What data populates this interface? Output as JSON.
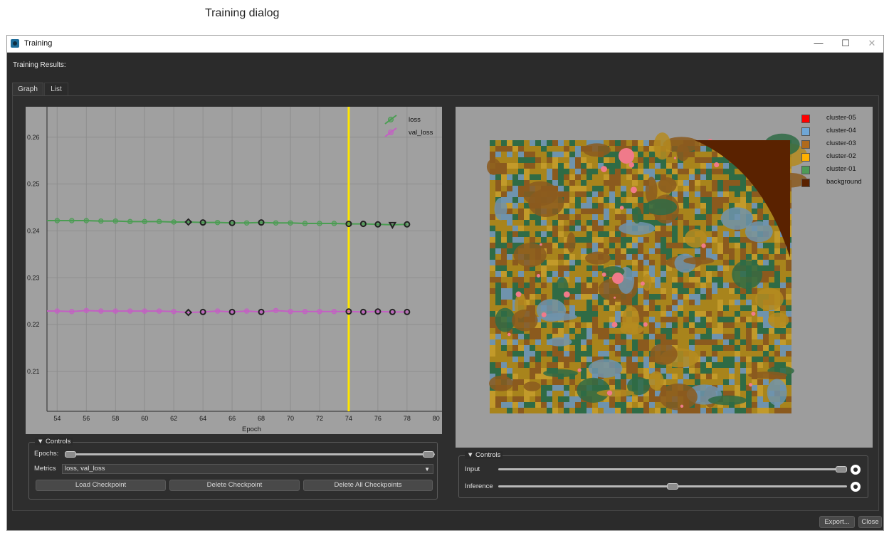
{
  "caption": "Training dialog",
  "window": {
    "title": "Training",
    "minimize_glyph": "—",
    "maximize_glyph": "☐",
    "close_glyph": "✕"
  },
  "results_label": "Training Results:",
  "tabs": [
    {
      "label": "Graph",
      "active": true
    },
    {
      "label": "List",
      "active": false
    }
  ],
  "chart_data": {
    "type": "line",
    "xlabel": "Epoch",
    "ylabel": "",
    "xlim": [
      53.3,
      80.4
    ],
    "ylim": [
      0.2015,
      0.2665
    ],
    "x_ticks": [
      "54",
      "56",
      "58",
      "60",
      "62",
      "64",
      "66",
      "68",
      "70",
      "72",
      "74",
      "76",
      "78",
      "80"
    ],
    "y_ticks": [
      "0.21",
      "0.22",
      "0.23",
      "0.24",
      "0.25",
      "0.26"
    ],
    "grid": true,
    "legend_position": "top-right",
    "highlight_epoch": 74,
    "x": [
      54,
      55,
      56,
      57,
      58,
      59,
      60,
      61,
      62,
      63,
      64,
      65,
      66,
      67,
      68,
      69,
      70,
      71,
      72,
      73,
      74,
      75,
      76,
      77,
      78
    ],
    "checkpoint_epochs": [
      63,
      64,
      66,
      68,
      74,
      75,
      76,
      77,
      78
    ],
    "series": [
      {
        "name": "loss",
        "color": "#4a9d52",
        "values": [
          0.2422,
          0.2422,
          0.2422,
          0.2421,
          0.2421,
          0.242,
          0.242,
          0.242,
          0.2419,
          0.2419,
          0.2418,
          0.2418,
          0.2417,
          0.2417,
          0.2418,
          0.2417,
          0.2417,
          0.2416,
          0.2416,
          0.2416,
          0.2415,
          0.2415,
          0.2414,
          0.2413,
          0.2414
        ]
      },
      {
        "name": "val_loss",
        "color": "#c45ec4",
        "values": [
          0.2229,
          0.2228,
          0.223,
          0.2229,
          0.2229,
          0.2229,
          0.2229,
          0.2229,
          0.2228,
          0.2226,
          0.2227,
          0.2229,
          0.2227,
          0.2229,
          0.2227,
          0.223,
          0.2228,
          0.2228,
          0.2228,
          0.2228,
          0.2228,
          0.2227,
          0.2228,
          0.2227,
          0.2227
        ]
      }
    ]
  },
  "left_controls": {
    "title": "Controls",
    "epochs_label": "Epochs:",
    "epochs_range": [
      0,
      1
    ],
    "metrics_label": "Metrics",
    "metrics_value": "loss, val_loss",
    "buttons": [
      "Load Checkpoint",
      "Delete Checkpoint",
      "Delete All Checkpoints"
    ]
  },
  "legend_clusters": [
    {
      "label": "cluster-05",
      "color": "#ff0000"
    },
    {
      "label": "cluster-04",
      "color": "#6fa6d6"
    },
    {
      "label": "cluster-03",
      "color": "#b06a1c"
    },
    {
      "label": "cluster-02",
      "color": "#ffb000"
    },
    {
      "label": "cluster-01",
      "color": "#4e9a57"
    },
    {
      "label": "background",
      "color": "#5a2200"
    }
  ],
  "right_controls": {
    "title": "Controls",
    "input_label": "Input",
    "input_level": 1.0,
    "inference_label": "Inference",
    "inference_level": 0.5
  },
  "footer": {
    "export_label": "Export...",
    "close_label": "Close"
  }
}
